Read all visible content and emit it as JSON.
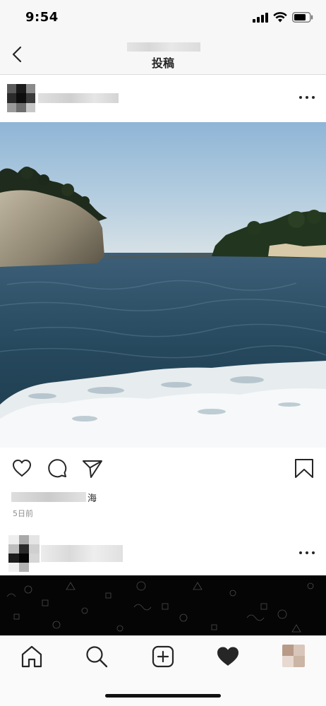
{
  "status_bar": {
    "time": "9:54"
  },
  "header": {
    "title": "投稿"
  },
  "post": {
    "location_text": "海",
    "time_ago": "5日前"
  },
  "icons": {
    "back": "chevron-left-icon",
    "more": "more-horizontal-icon",
    "like": "heart-outline-icon",
    "comment": "comment-icon",
    "share": "paper-plane-icon",
    "save": "bookmark-icon",
    "home": "home-icon",
    "search": "search-icon",
    "new_post": "add-square-icon",
    "activity": "heart-filled-icon"
  },
  "colors": {
    "text": "#262626",
    "secondary_text": "#8e8e8e",
    "divider": "#dbdbdb",
    "header_bg": "#f7f7f7"
  }
}
